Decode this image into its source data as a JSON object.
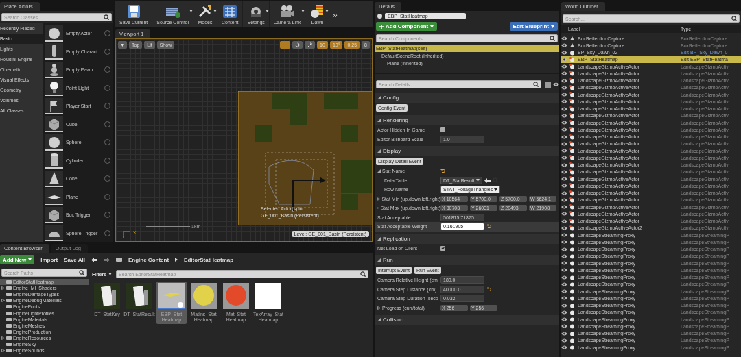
{
  "toolbar": {
    "buttons": [
      {
        "label": "Save Current",
        "kind": "save",
        "dropdown": false
      },
      {
        "label": "Source Control",
        "kind": "source",
        "dropdown": true
      },
      {
        "label": "Modes",
        "kind": "modes",
        "dropdown": true
      },
      {
        "label": "Content",
        "kind": "content",
        "dropdown": false
      },
      {
        "label": "Settings",
        "kind": "settings",
        "dropdown": true
      },
      {
        "label": "Camera Link",
        "kind": "camera",
        "dropdown": true
      },
      {
        "label": "Dawn",
        "kind": "dawn",
        "dropdown": true
      }
    ],
    "more": "»"
  },
  "place_actors": {
    "tab": "Place Actors",
    "search": {
      "placeholder": "Search Classes"
    },
    "categories": [
      {
        "label": "Recently Placed",
        "selected": false
      },
      {
        "label": "Basic",
        "selected": true
      },
      {
        "label": "Lights",
        "selected": false
      },
      {
        "label": "Houdini Engine",
        "selected": false
      },
      {
        "label": "Cinematic",
        "selected": false
      },
      {
        "label": "Visual Effects",
        "selected": false
      },
      {
        "label": "Geometry",
        "selected": false
      },
      {
        "label": "Volumes",
        "selected": false
      },
      {
        "label": "All Classes",
        "selected": false
      }
    ],
    "items": [
      {
        "label": "Empty Actor",
        "kind": "sphere"
      },
      {
        "label": "Empty Charact",
        "kind": "capsule"
      },
      {
        "label": "Empty Pawn",
        "kind": "pawn"
      },
      {
        "label": "Point Light",
        "kind": "bulb"
      },
      {
        "label": "Player Start",
        "kind": "flag"
      },
      {
        "label": "Cube",
        "kind": "cube"
      },
      {
        "label": "Sphere",
        "kind": "sphere"
      },
      {
        "label": "Cylinder",
        "kind": "cylinder"
      },
      {
        "label": "Cone",
        "kind": "cone"
      },
      {
        "label": "Plane",
        "kind": "plane"
      },
      {
        "label": "Box Trigger",
        "kind": "cube"
      },
      {
        "label": "Sphere Trigger",
        "kind": "dome"
      }
    ]
  },
  "viewport": {
    "tab": "Viewport 1",
    "view_buttons": [
      "Top",
      "Lit",
      "Show"
    ],
    "transform_tools": [
      {
        "kind": "move",
        "selected": true
      },
      {
        "kind": "rotate",
        "selected": false
      },
      {
        "kind": "scale",
        "selected": false
      }
    ],
    "snaps": [
      {
        "value": "10",
        "on": true
      },
      {
        "value": "10°",
        "on": true
      },
      {
        "value": "0.25",
        "on": true
      },
      {
        "value": "8",
        "on": false
      }
    ],
    "scale_label": "1km",
    "axis_label": "X",
    "selection_note": [
      "Selected Actor(s) in",
      "GE_001_Basin (Persistent)"
    ],
    "level": "Level:  GE_001_Basin (Persistent)"
  },
  "content_browser": {
    "tabs": [
      {
        "label": "Content Browser",
        "selected": true
      },
      {
        "label": "Output Log",
        "selected": false
      }
    ],
    "add_new": "Add New",
    "import": "Import",
    "save_all": "Save All",
    "breadcrumb": [
      "Engine Content",
      "EditorStatHeatmap"
    ],
    "path_search": {
      "placeholder": "Search Paths"
    },
    "filters": "Filters",
    "asset_search": {
      "placeholder": "Search EditorStatHeatmap"
    },
    "folders": [
      {
        "label": "EditorStatHeatmap",
        "selected": true,
        "expandable": false
      },
      {
        "label": "Engine_MI_Shaders",
        "selected": false,
        "expandable": true
      },
      {
        "label": "EngineDamageTypes",
        "selected": false,
        "expandable": false
      },
      {
        "label": "EngineDebugMaterials",
        "selected": false,
        "expandable": true
      },
      {
        "label": "EngineFonts",
        "selected": false,
        "expandable": false
      },
      {
        "label": "EngineLightProfiles",
        "selected": false,
        "expandable": false
      },
      {
        "label": "EngineMaterials",
        "selected": false,
        "expandable": false
      },
      {
        "label": "EngineMeshes",
        "selected": false,
        "expandable": false
      },
      {
        "label": "EngineProduction",
        "selected": false,
        "expandable": false
      },
      {
        "label": "EngineResources",
        "selected": false,
        "expandable": true
      },
      {
        "label": "EngineSky",
        "selected": false,
        "expandable": false
      },
      {
        "label": "EngineSounds",
        "selected": false,
        "expandable": true
      }
    ],
    "assets": [
      {
        "label": "DT_StatKey",
        "kind": "table",
        "selected": false
      },
      {
        "label": "DT_StatResult",
        "kind": "table",
        "selected": false
      },
      {
        "label": "EBP_Stat Heatmap",
        "kind": "blueprint",
        "selected": true
      },
      {
        "label": "MatIns_Stat Heatmap",
        "kind": "material",
        "color": "#e2d24a",
        "selected": false
      },
      {
        "label": "Mat_Stat Heatmap",
        "kind": "material",
        "color": "#e24a2a",
        "selected": false
      },
      {
        "label": "TexArray_Stat Heatmap",
        "kind": "texture",
        "color": "#ffffff",
        "selected": false
      }
    ]
  },
  "details": {
    "tab": "Details",
    "actor_name": "EBP_StatHeatmap",
    "add_component": "Add Component",
    "edit_blueprint": "Edit Blueprint",
    "component_search": {
      "placeholder": "Search Components"
    },
    "components": [
      {
        "label": "EBP_StatHeatmap(self)",
        "selected": true,
        "children": [
          {
            "label": "DefaultSceneRoot (Inherited)",
            "selected": false,
            "children": [
              {
                "label": "Plane (Inherited)",
                "selected": false
              }
            ]
          }
        ]
      }
    ],
    "details_search": {
      "placeholder": "Search Details"
    },
    "sections": [
      {
        "title": "Config",
        "rows": [
          {
            "kind": "buttons",
            "buttons": [
              "Config Event"
            ]
          }
        ]
      },
      {
        "title": "Rendering",
        "rows": [
          {
            "kind": "checkbox",
            "label": "Actor Hidden In Game",
            "checked": false
          },
          {
            "kind": "number",
            "label": "Editor Billboard Scale",
            "value": "1.0"
          }
        ]
      },
      {
        "title": "Display",
        "rows": [
          {
            "kind": "buttons",
            "buttons": [
              "Display Detail Event"
            ]
          },
          {
            "kind": "group",
            "label": "Stat Name",
            "expanded": true,
            "reset": true,
            "children": [
              {
                "kind": "asset",
                "label": "Data Table",
                "value": "DT_StatResult"
              },
              {
                "kind": "combo",
                "label": "Row Name",
                "value": "STAT_FoliageTriangles"
              }
            ]
          },
          {
            "kind": "vector",
            "label": "Stat Min (up,down,left,right)",
            "expanded": false,
            "fields": [
              {
                "axis": "X",
                "value": "10564"
              },
              {
                "axis": "Y",
                "value": "5700.0"
              },
              {
                "axis": "Z",
                "value": "5700.0"
              },
              {
                "axis": "W",
                "value": "5624.1"
              }
            ]
          },
          {
            "kind": "vector",
            "label": "Stat Max (up,down,left,right)",
            "expanded": false,
            "fields": [
              {
                "axis": "X",
                "value": "30703"
              },
              {
                "axis": "Y",
                "value": "26031"
              },
              {
                "axis": "Z",
                "value": "20493"
              },
              {
                "axis": "W",
                "value": "21908"
              }
            ]
          },
          {
            "kind": "number",
            "label": "Stat Acceptable",
            "value": "501815.71875"
          },
          {
            "kind": "number",
            "label": "Stat Acceptable Weight",
            "value": "0.161905",
            "highlighted": true,
            "reset": true
          }
        ]
      },
      {
        "title": "Replication",
        "rows": [
          {
            "kind": "checkbox",
            "label": "Net Load on Client",
            "checked": true
          }
        ]
      },
      {
        "title": "Run",
        "rows": [
          {
            "kind": "buttons",
            "buttons": [
              "Interrupt Event",
              "Run Event"
            ]
          },
          {
            "kind": "number",
            "label": "Camera Relative Height (cm",
            "value": "180.0"
          },
          {
            "kind": "number",
            "label": "Camera Step Distance (cm)",
            "value": "40000.0",
            "reset": true
          },
          {
            "kind": "number",
            "label": "Camera Step Duration (seco",
            "value": "0.032"
          },
          {
            "kind": "vector",
            "label": "Progress (curr/total)",
            "expanded": false,
            "fields": [
              {
                "axis": "X",
                "value": "256"
              },
              {
                "axis": "Y",
                "value": "256"
              }
            ]
          }
        ]
      },
      {
        "title": "Collision"
      }
    ]
  },
  "outliner": {
    "tab": "World Outliner",
    "search": {
      "placeholder": "Search..."
    },
    "columns": [
      "Label",
      "Type"
    ],
    "rows": [
      {
        "label": "BoxReflectionCapture",
        "type": "BoxReflectionCapture",
        "kind": "capture",
        "link": false,
        "selected": false
      },
      {
        "label": "BoxReflectionCapture",
        "type": "BoxReflectionCapture",
        "kind": "capture",
        "link": false,
        "selected": false
      },
      {
        "label": "BP_Sky_Dawn_02",
        "type": "Edit BP_Sky_Dawn_0",
        "kind": "actor",
        "link": true,
        "selected": false
      },
      {
        "label": "EBP_StatHeatmap",
        "type": "Edit EBP_StatHeatma",
        "kind": "gizmo",
        "link": true,
        "selected": true
      },
      {
        "label": "LandscapeGizmoActiveActor",
        "type": "LandscapeGizmoActiv",
        "kind": "gizmo",
        "link": false,
        "selected": false
      },
      {
        "label": "LandscapeGizmoActiveActor",
        "type": "LandscapeGizmoActiv",
        "kind": "gizmo",
        "link": false,
        "selected": false
      },
      {
        "label": "LandscapeGizmoActiveActor",
        "type": "LandscapeGizmoActiv",
        "kind": "gizmo",
        "link": false,
        "selected": false
      },
      {
        "label": "LandscapeGizmoActiveActor",
        "type": "LandscapeGizmoActiv",
        "kind": "gizmo",
        "link": false,
        "selected": false
      },
      {
        "label": "LandscapeGizmoActiveActor",
        "type": "LandscapeGizmoActiv",
        "kind": "gizmo",
        "link": false,
        "selected": false
      },
      {
        "label": "LandscapeGizmoActiveActor",
        "type": "LandscapeGizmoActiv",
        "kind": "gizmo",
        "link": false,
        "selected": false
      },
      {
        "label": "LandscapeGizmoActiveActor",
        "type": "LandscapeGizmoActiv",
        "kind": "gizmo",
        "link": false,
        "selected": false
      },
      {
        "label": "LandscapeGizmoActiveActor",
        "type": "LandscapeGizmoActiv",
        "kind": "gizmo",
        "link": false,
        "selected": false
      },
      {
        "label": "LandscapeGizmoActiveActor",
        "type": "LandscapeGizmoActiv",
        "kind": "gizmo",
        "link": false,
        "selected": false
      },
      {
        "label": "LandscapeGizmoActiveActor",
        "type": "LandscapeGizmoActiv",
        "kind": "gizmo",
        "link": false,
        "selected": false
      },
      {
        "label": "LandscapeGizmoActiveActor",
        "type": "LandscapeGizmoActiv",
        "kind": "gizmo",
        "link": false,
        "selected": false
      },
      {
        "label": "LandscapeGizmoActiveActor",
        "type": "LandscapeGizmoActiv",
        "kind": "gizmo",
        "link": false,
        "selected": false
      },
      {
        "label": "LandscapeGizmoActiveActor",
        "type": "LandscapeGizmoActiv",
        "kind": "gizmo",
        "link": false,
        "selected": false
      },
      {
        "label": "LandscapeGizmoActiveActor",
        "type": "LandscapeGizmoActiv",
        "kind": "gizmo",
        "link": false,
        "selected": false
      },
      {
        "label": "LandscapeGizmoActiveActor",
        "type": "LandscapeGizmoActiv",
        "kind": "gizmo",
        "link": false,
        "selected": false
      },
      {
        "label": "LandscapeGizmoActiveActor",
        "type": "LandscapeGizmoActiv",
        "kind": "gizmo",
        "link": false,
        "selected": false
      },
      {
        "label": "LandscapeGizmoActiveActor",
        "type": "LandscapeGizmoActiv",
        "kind": "gizmo",
        "link": false,
        "selected": false
      },
      {
        "label": "LandscapeGizmoActiveActor",
        "type": "LandscapeGizmoActiv",
        "kind": "gizmo",
        "link": false,
        "selected": false
      },
      {
        "label": "LandscapeGizmoActiveActor",
        "type": "LandscapeGizmoActiv",
        "kind": "gizmo",
        "link": false,
        "selected": false
      },
      {
        "label": "LandscapeGizmoActiveActor",
        "type": "LandscapeGizmoActiv",
        "kind": "gizmo",
        "link": false,
        "selected": false
      },
      {
        "label": "LandscapeGizmoActiveActor",
        "type": "LandscapeGizmoActiv",
        "kind": "gizmo",
        "link": false,
        "selected": false
      },
      {
        "label": "LandscapeGizmoActiveActor",
        "type": "LandscapeGizmoActiv",
        "kind": "gizmo",
        "link": false,
        "selected": false
      },
      {
        "label": "LandscapeGizmoActiveActor",
        "type": "LandscapeGizmoActiv",
        "kind": "gizmo",
        "link": false,
        "selected": false
      },
      {
        "label": "LandscapeGizmoActiveActor2",
        "type": "LandscapeGizmoActiv",
        "kind": "gizmo",
        "link": false,
        "selected": false
      },
      {
        "label": "LandscapeStreamingProxy",
        "type": "LandscapeStreamingP",
        "kind": "actor",
        "link": false,
        "selected": false
      },
      {
        "label": "LandscapeStreamingProxy",
        "type": "LandscapeStreamingP",
        "kind": "actor",
        "link": false,
        "selected": false
      },
      {
        "label": "LandscapeStreamingProxy",
        "type": "LandscapeStreamingP",
        "kind": "actor",
        "link": false,
        "selected": false
      },
      {
        "label": "LandscapeStreamingProxy",
        "type": "LandscapeStreamingP",
        "kind": "actor",
        "link": false,
        "selected": false
      },
      {
        "label": "LandscapeStreamingProxy",
        "type": "LandscapeStreamingP",
        "kind": "actor",
        "link": false,
        "selected": false
      },
      {
        "label": "LandscapeStreamingProxy",
        "type": "LandscapeStreamingP",
        "kind": "actor",
        "link": false,
        "selected": false
      },
      {
        "label": "LandscapeStreamingProxy",
        "type": "LandscapeStreamingP",
        "kind": "actor",
        "link": false,
        "selected": false
      },
      {
        "label": "LandscapeStreamingProxy",
        "type": "LandscapeStreamingP",
        "kind": "actor",
        "link": false,
        "selected": false
      },
      {
        "label": "LandscapeStreamingProxy",
        "type": "LandscapeStreamingP",
        "kind": "actor",
        "link": false,
        "selected": false
      },
      {
        "label": "LandscapeStreamingProxy",
        "type": "LandscapeStreamingP",
        "kind": "actor",
        "link": false,
        "selected": false
      },
      {
        "label": "LandscapeStreamingProxy",
        "type": "LandscapeStreamingP",
        "kind": "actor",
        "link": false,
        "selected": false
      },
      {
        "label": "LandscapeStreamingProxy",
        "type": "LandscapeStreamingP",
        "kind": "actor",
        "link": false,
        "selected": false
      },
      {
        "label": "LandscapeStreamingProxy",
        "type": "LandscapeStreamingP",
        "kind": "actor",
        "link": false,
        "selected": false
      },
      {
        "label": "LandscapeStreamingProxy",
        "type": "LandscapeStreamingP",
        "kind": "actor",
        "link": false,
        "selected": false
      },
      {
        "label": "LandscapeStreamingProxy",
        "type": "LandscapeStreamingP",
        "kind": "actor",
        "link": false,
        "selected": false
      },
      {
        "label": "LandscapeStreamingProxy",
        "type": "LandscapeStreamingP",
        "kind": "actor",
        "link": false,
        "selected": false
      },
      {
        "label": "LandscapeStreamingProxy",
        "type": "LandscapeStreamingP",
        "kind": "actor",
        "link": false,
        "selected": false
      }
    ]
  }
}
